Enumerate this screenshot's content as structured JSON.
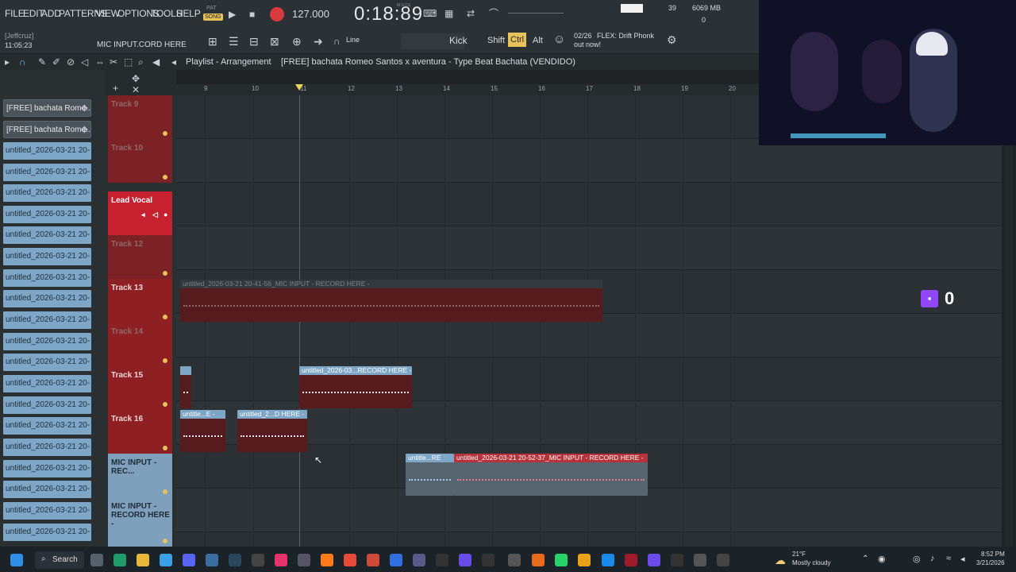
{
  "menu": [
    "FILE",
    "EDIT",
    "ADD",
    "PATTERNS",
    "VIEW",
    "OPTIONS",
    "TOOLS",
    "HELP"
  ],
  "transport": {
    "pat": "PAT",
    "song": "SONG",
    "tempo": "127.000",
    "time": "0:18:89",
    "time_unit": "M:S:CS",
    "cpu": "39",
    "mem": "6069 MB",
    "voices": "0"
  },
  "hint": {
    "user": "[Jeffcruz]",
    "clock": "11:05:23",
    "hint_text": "MIC INPUT.CORD HERE"
  },
  "toolbar": {
    "snap": "Line",
    "channel": "Kick",
    "shift": "Shift",
    "ctrl": "Ctrl",
    "alt": "Alt",
    "news_count": "02/26",
    "news": "FLEX: Drift Phonk",
    "news2": "out now!"
  },
  "playlist": {
    "label": "Playlist - Arrangement",
    "project": "[FREE] bachata Romeo Santos x aventura - Type Beat Bachata (VENDIDO)"
  },
  "ruler": [
    "9",
    "10",
    "11",
    "12",
    "13",
    "14",
    "15",
    "16",
    "17",
    "18",
    "19",
    "20"
  ],
  "browser": {
    "projects": [
      "[FREE] bachata Rome...",
      "[FREE] bachata Rome..."
    ],
    "clip_label": "untitled_2026-03-21 20-"
  },
  "tracks": [
    {
      "name": "Track 9"
    },
    {
      "name": "Track 10"
    },
    {
      "name": "Lead Vocal"
    },
    {
      "name": "Track 12"
    },
    {
      "name": "Track 13"
    },
    {
      "name": "Track 14"
    },
    {
      "name": "Track 15"
    },
    {
      "name": "Track 16"
    },
    {
      "name": "MIC INPUT - REC..."
    },
    {
      "name": "MIC INPUT - RECORD HERE -"
    }
  ],
  "clips": {
    "c13": "untitled_2026-03-21 20-41-56_MIC INPUT - RECORD HERE -",
    "c15a": "",
    "c15b": "untitled_2026-03...RECORD HERE -",
    "c16a": "untitle...E -",
    "c16b": "untitled_2...D HERE -",
    "c17a": "untitle...RE",
    "c17b": "untitled_2026-03-21 20-52-37_MIC INPUT - RECORD HERE -"
  },
  "twitch": {
    "count": "0"
  },
  "taskbar": {
    "search": "Search",
    "weather_temp": "21°F",
    "weather_desc": "Mostly cloudy",
    "time": "8:52 PM",
    "date": "3/21/2026"
  },
  "colors": {
    "red_track": "#8e2024",
    "blue_clip": "#7ea6c7",
    "accent_orange": "#e8c35a"
  }
}
